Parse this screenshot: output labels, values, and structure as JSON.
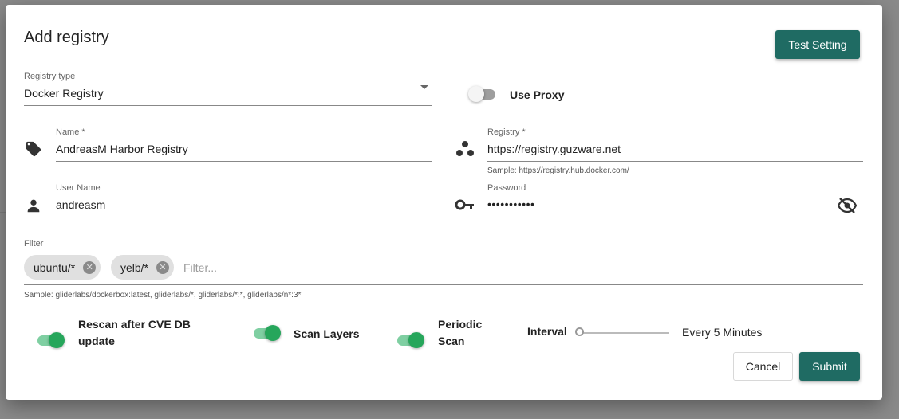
{
  "dialog": {
    "title": "Add registry",
    "test_setting_label": "Test Setting",
    "cancel_label": "Cancel",
    "submit_label": "Submit"
  },
  "registry_type": {
    "label": "Registry type",
    "value": "Docker Registry"
  },
  "use_proxy": {
    "label": "Use Proxy",
    "enabled": false
  },
  "name": {
    "label": "Name *",
    "value": "AndreasM Harbor Registry"
  },
  "registry": {
    "label": "Registry *",
    "value": "https://registry.guzware.net",
    "hint": "Sample: https://registry.hub.docker.com/"
  },
  "username": {
    "label": "User Name",
    "value": "andreasm"
  },
  "password": {
    "label": "Password",
    "value": "•••••••••••"
  },
  "filter": {
    "label": "Filter",
    "chips": [
      "ubuntu/*",
      "yelb/*"
    ],
    "placeholder": "Filter...",
    "hint": "Sample: gliderlabs/dockerbox:latest, gliderlabs/*, gliderlabs/*:*, gliderlabs/n*:3*"
  },
  "rescan": {
    "label_line1": "Rescan after CVE DB",
    "label_line2": "update",
    "enabled": true
  },
  "scan_layers": {
    "label": "Scan Layers",
    "enabled": true
  },
  "periodic_scan": {
    "label_line1": "Periodic",
    "label_line2": "Scan",
    "enabled": true
  },
  "interval": {
    "label": "Interval",
    "value_text": "Every 5 Minutes",
    "level": 0
  },
  "colors": {
    "primary": "#1f6b63",
    "toggle_on": "#26a65b"
  },
  "icons": {
    "name": "tag-icon",
    "registry": "registry-dots-icon",
    "username": "person-icon",
    "password": "key-icon",
    "visibility": "eye-off-icon",
    "dropdown": "dropdown-arrow-icon"
  }
}
